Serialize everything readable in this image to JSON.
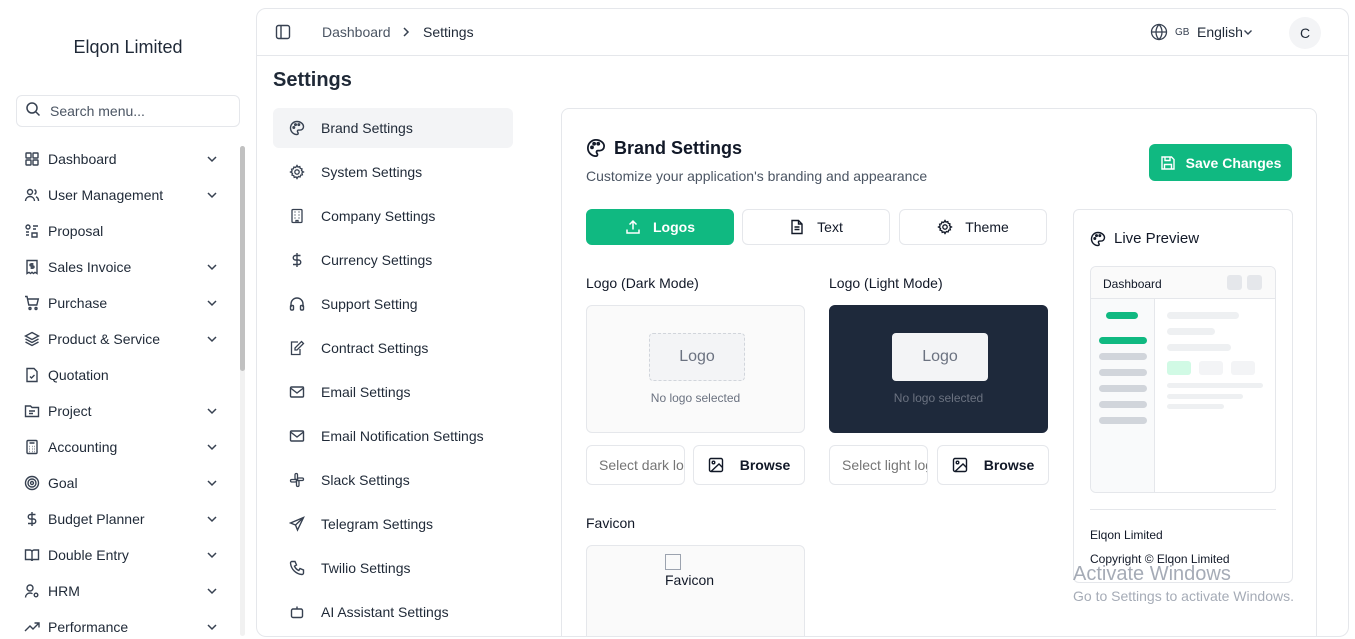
{
  "sidebar": {
    "brand": "Elqon Limited",
    "search_placeholder": "Search menu...",
    "items": [
      {
        "label": "Dashboard",
        "icon": "grid-icon",
        "expandable": true
      },
      {
        "label": "User Management",
        "icon": "users-icon",
        "expandable": true
      },
      {
        "label": "Proposal",
        "icon": "proposal-icon",
        "expandable": false
      },
      {
        "label": "Sales Invoice",
        "icon": "invoice-icon",
        "expandable": true
      },
      {
        "label": "Purchase",
        "icon": "cart-icon",
        "expandable": true
      },
      {
        "label": "Product & Service",
        "icon": "layers-icon",
        "expandable": true
      },
      {
        "label": "Quotation",
        "icon": "file-check-icon",
        "expandable": false
      },
      {
        "label": "Project",
        "icon": "folder-icon",
        "expandable": true
      },
      {
        "label": "Accounting",
        "icon": "calculator-icon",
        "expandable": true
      },
      {
        "label": "Goal",
        "icon": "target-icon",
        "expandable": true
      },
      {
        "label": "Budget Planner",
        "icon": "dollar-icon",
        "expandable": true
      },
      {
        "label": "Double Entry",
        "icon": "book-icon",
        "expandable": true
      },
      {
        "label": "HRM",
        "icon": "user-cog-icon",
        "expandable": true
      },
      {
        "label": "Performance",
        "icon": "trend-icon",
        "expandable": true
      }
    ]
  },
  "topbar": {
    "breadcrumb": [
      "Dashboard",
      "Settings"
    ],
    "flag": "GB",
    "language": "English",
    "avatar_initial": "C"
  },
  "page": {
    "title": "Settings"
  },
  "settings_nav": [
    {
      "label": "Brand Settings",
      "icon": "palette-icon",
      "active": true
    },
    {
      "label": "System Settings",
      "icon": "gear-icon",
      "active": false
    },
    {
      "label": "Company Settings",
      "icon": "building-icon",
      "active": false
    },
    {
      "label": "Currency Settings",
      "icon": "dollar-icon",
      "active": false
    },
    {
      "label": "Support Setting",
      "icon": "headphones-icon",
      "active": false
    },
    {
      "label": "Contract Settings",
      "icon": "pen-doc-icon",
      "active": false
    },
    {
      "label": "Email Settings",
      "icon": "mail-icon",
      "active": false
    },
    {
      "label": "Email Notification Settings",
      "icon": "mail-icon",
      "active": false
    },
    {
      "label": "Slack Settings",
      "icon": "slack-icon",
      "active": false
    },
    {
      "label": "Telegram Settings",
      "icon": "send-icon",
      "active": false
    },
    {
      "label": "Twilio Settings",
      "icon": "phone-icon",
      "active": false
    },
    {
      "label": "AI Assistant Settings",
      "icon": "bot-icon",
      "active": false
    }
  ],
  "brand": {
    "title": "Brand Settings",
    "subtitle": "Customize your application's branding and appearance",
    "save_label": "Save Changes",
    "tabs": [
      {
        "label": "Logos",
        "icon": "upload-icon",
        "active": true
      },
      {
        "label": "Text",
        "icon": "file-text-icon",
        "active": false
      },
      {
        "label": "Theme",
        "icon": "gear-icon",
        "active": false
      }
    ],
    "logo_dark": {
      "label": "Logo (Dark Mode)",
      "placeholder_text": "Logo",
      "status": "No logo selected",
      "input_placeholder": "Select dark logo...",
      "browse": "Browse"
    },
    "logo_light": {
      "label": "Logo (Light Mode)",
      "placeholder_text": "Logo",
      "status": "No logo selected",
      "input_placeholder": "Select light logo...",
      "browse": "Browse"
    },
    "favicon": {
      "label": "Favicon",
      "alt": "Favicon"
    }
  },
  "preview": {
    "title": "Live Preview",
    "mini_header": "Dashboard",
    "company": "Elqon Limited",
    "copyright": "Copyright © Elqon Limited"
  },
  "watermark": {
    "line1": "Activate Windows",
    "line2": "Go to Settings to activate Windows."
  },
  "colors": {
    "accent": "#10b981",
    "dark_logo_bg": "#1e293b"
  }
}
